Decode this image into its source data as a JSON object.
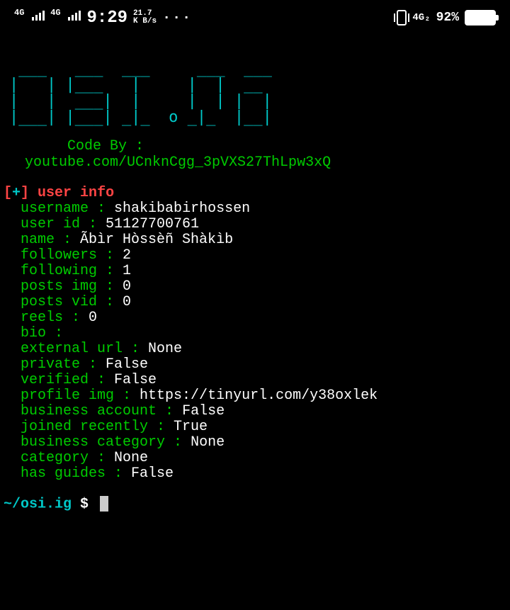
{
  "statusbar": {
    "sig1_label": "4G",
    "sig2_label": "4G",
    "time": "9:29",
    "speed_top": "21.7",
    "speed_bottom": "K B/s",
    "dots": "···",
    "net": "4G₂",
    "battery_pct": "92%"
  },
  "banner": {
    "ascii": " ___   ___  ___     ___  ___\n|   | |___   |     |  |  __\n|   |  ___|  |     |  | |  |\n|___| |___| _|_  o _|_  |__|"
  },
  "credits": {
    "label": "Code By :",
    "url": "youtube.com/UCnknCgg_3pVXS27ThLpw3xQ"
  },
  "section": {
    "bracket_l": "[",
    "plus": "+",
    "bracket_r": "]",
    "title": " user info"
  },
  "info": [
    {
      "key": "username",
      "value": "shakibabirhossen"
    },
    {
      "key": "user id",
      "value": "51127700761"
    },
    {
      "key": "name",
      "value": "Ãbìr Hòssèñ Shàkìb"
    },
    {
      "key": "followers",
      "value": "2"
    },
    {
      "key": "following",
      "value": "1"
    },
    {
      "key": "posts img",
      "value": "0"
    },
    {
      "key": "posts vid",
      "value": "0"
    },
    {
      "key": "reels",
      "value": "0"
    },
    {
      "key": "bio",
      "value": ""
    },
    {
      "key": "external url",
      "value": "None"
    },
    {
      "key": "private",
      "value": "False"
    },
    {
      "key": "verified",
      "value": "False"
    },
    {
      "key": "profile img",
      "value": "https://tinyurl.com/y38oxlek"
    },
    {
      "key": "business account",
      "value": "False"
    },
    {
      "key": "joined recently",
      "value": "True"
    },
    {
      "key": "business category",
      "value": "None"
    },
    {
      "key": "category",
      "value": "None"
    },
    {
      "key": "has guides",
      "value": "False"
    }
  ],
  "prompt": {
    "path": "~/osi.ig",
    "symbol": "$"
  }
}
